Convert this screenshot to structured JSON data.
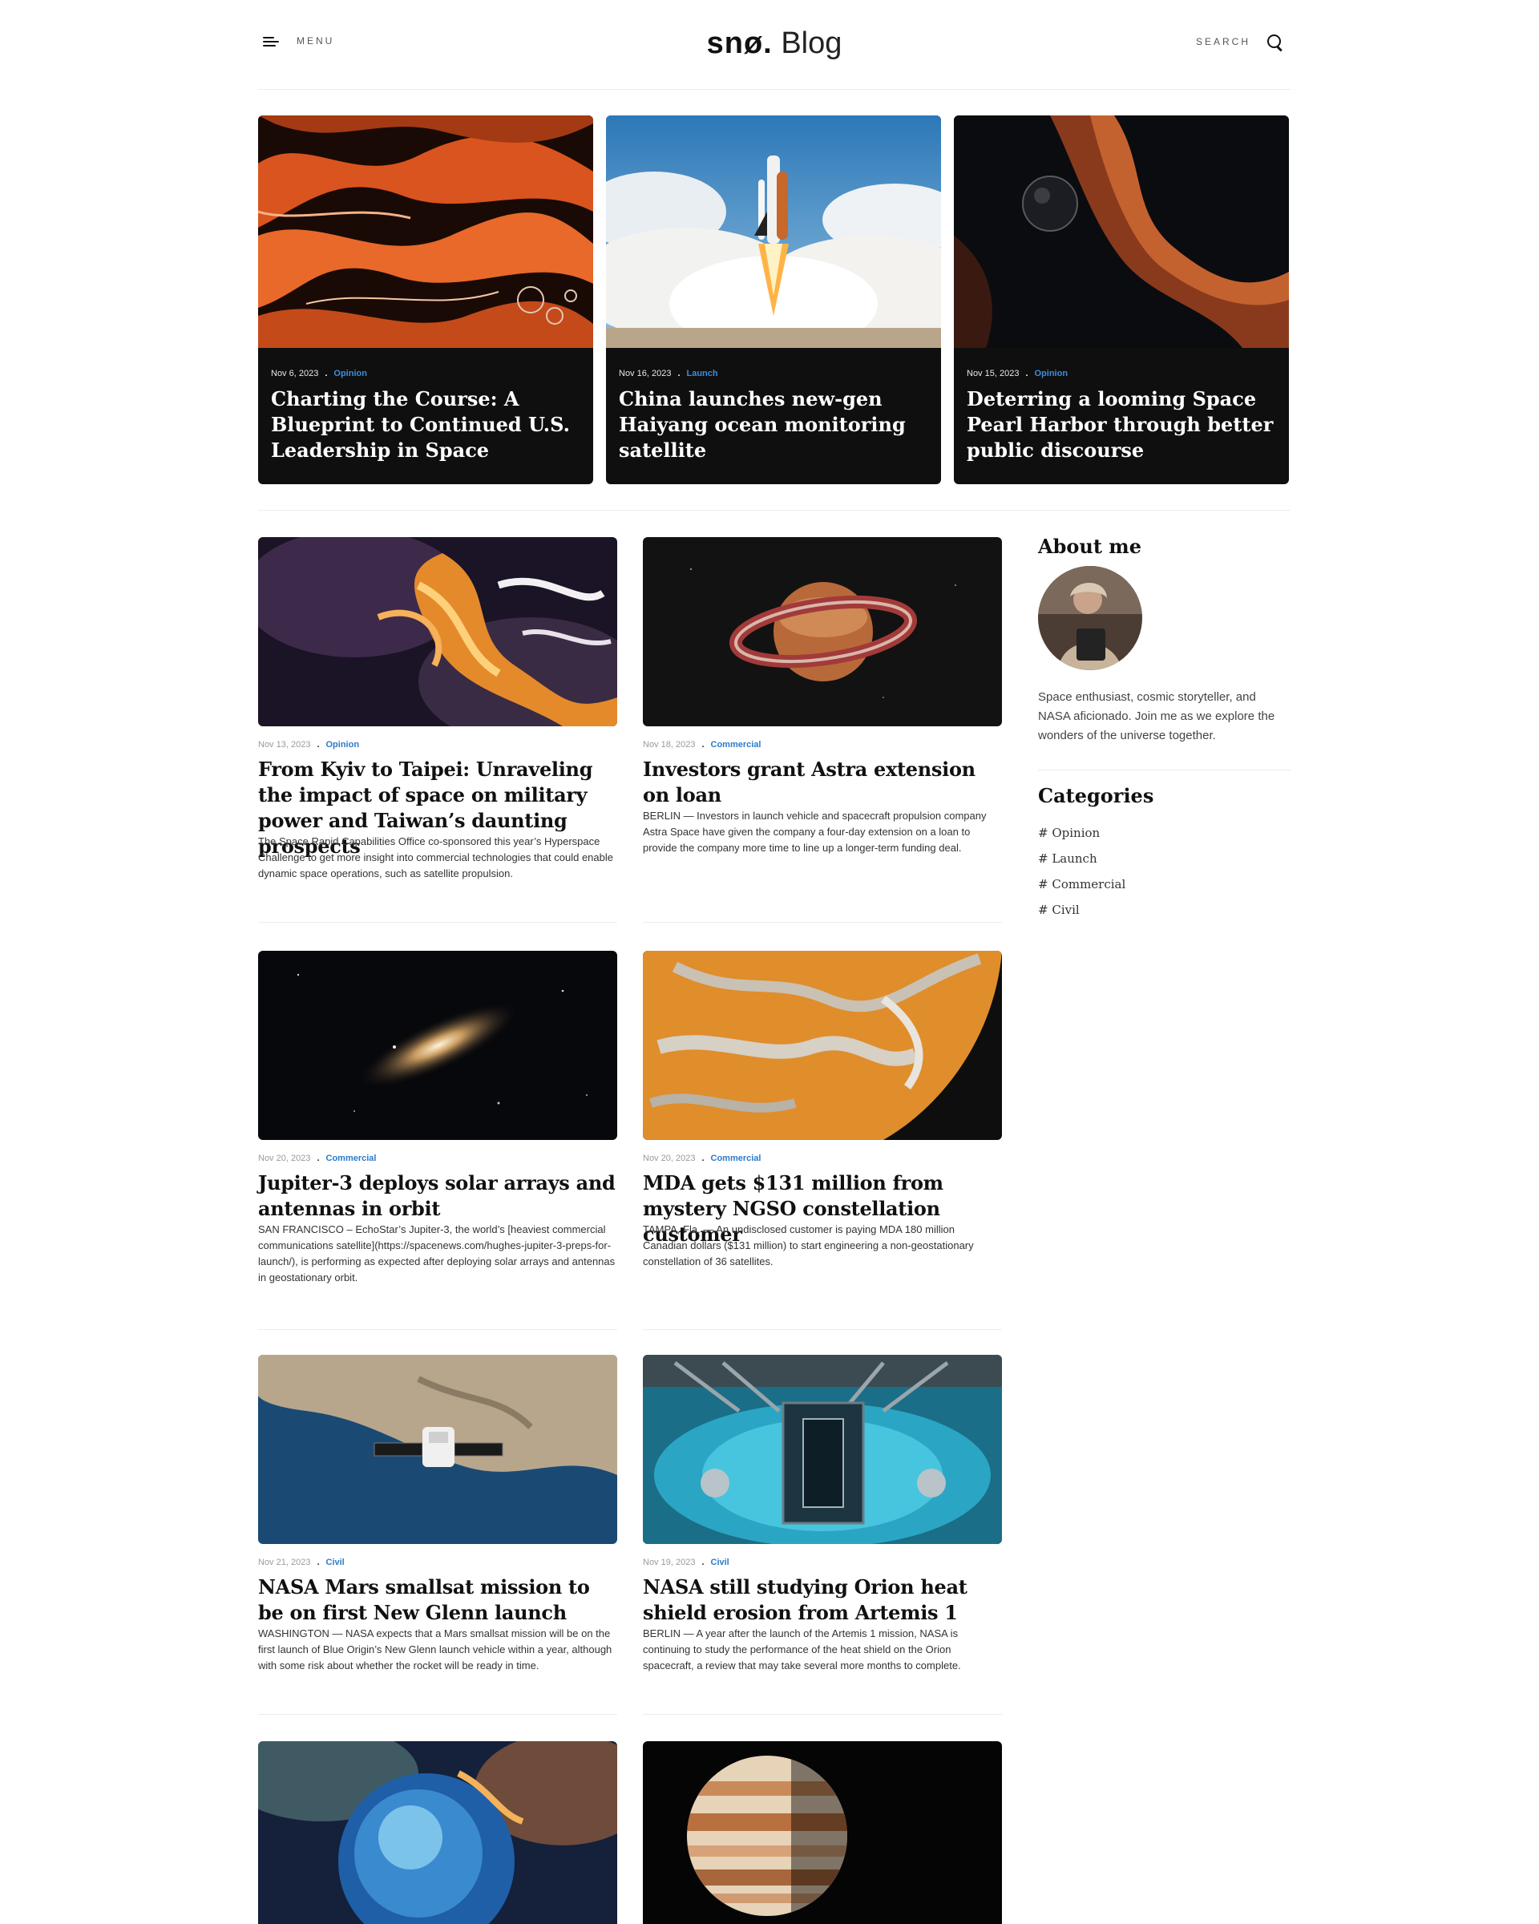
{
  "header": {
    "menu_label": "MENU",
    "brand_bold": "snø.",
    "brand_light": "Blog",
    "search_label": "SEARCH"
  },
  "featured": [
    {
      "date": "Nov 6, 2023",
      "category": "Opinion",
      "title": "Charting the Course: A Blueprint to Continued U.S. Leadership in Space"
    },
    {
      "date": "Nov 16, 2023",
      "category": "Launch",
      "title": "China launches new-gen Haiyang ocean monitoring satellite"
    },
    {
      "date": "Nov 15, 2023",
      "category": "Opinion",
      "title": "Deterring a looming Space Pearl Harbor through better public discourse"
    }
  ],
  "posts": [
    {
      "date": "Nov 13, 2023",
      "category": "Opinion",
      "title": "From Kyiv to Taipei: Unraveling the impact of space on military power and Taiwan’s daunting prospects",
      "excerpt": "The Space Rapid Capabilities Office co-sponsored this year’s Hyperspace Challenge to get more insight into commercial technologies that could enable dynamic space operations, such as satellite propulsion."
    },
    {
      "date": "Nov 18, 2023",
      "category": "Commercial",
      "title": "Investors grant Astra extension on loan",
      "excerpt": "BERLIN — Investors in launch vehicle and spacecraft propulsion company Astra Space have given the company a four-day extension on a loan to provide the company more time to line up a longer-term funding deal."
    },
    {
      "date": "Nov 20, 2023",
      "category": "Commercial",
      "title": "Jupiter-3 deploys solar arrays and antennas in orbit",
      "excerpt": "SAN FRANCISCO – EchoStar’s Jupiter-3, the world’s [heaviest commercial communications satellite](https://spacenews.com/hughes-jupiter-3-preps-for-launch/), is performing as expected after deploying solar arrays and antennas in geostationary orbit."
    },
    {
      "date": "Nov 20, 2023",
      "category": "Commercial",
      "title": "MDA gets $131 million from mystery NGSO constellation customer",
      "excerpt": "TAMPA, Fla. — An undisclosed customer is paying MDA 180 million Canadian dollars ($131 million) to start engineering a non-geostationary constellation of 36 satellites."
    },
    {
      "date": "Nov 21, 2023",
      "category": "Civil",
      "title": "NASA Mars smallsat mission to be on first New Glenn launch",
      "excerpt": "WASHINGTON — NASA expects that a Mars smallsat mission will be on the first launch of Blue Origin’s New Glenn launch vehicle within a year, although with some risk about whether the rocket will be ready in time."
    },
    {
      "date": "Nov 19, 2023",
      "category": "Civil",
      "title": "NASA still studying Orion heat shield erosion from Artemis 1",
      "excerpt": "BERLIN — A year after the launch of the Artemis 1 mission, NASA is continuing to study the performance of the heat shield on the Orion spacecraft, a review that may take several more months to complete."
    },
    {
      "date": "",
      "category": "",
      "title": "",
      "excerpt": ""
    },
    {
      "date": "",
      "category": "",
      "title": "",
      "excerpt": ""
    }
  ],
  "sidebar": {
    "about_heading": "About me",
    "about_text": "Space enthusiast, cosmic storyteller, and NASA aficionado. Join me as we explore the wonders of the universe together.",
    "categories_heading": "Categories",
    "categories": [
      "# Opinion",
      "# Launch",
      "# Commercial",
      "# Civil"
    ]
  },
  "colors": {
    "accent": "#2c7bc9",
    "card_dark": "#0f0f0f",
    "divider": "#ececec"
  }
}
